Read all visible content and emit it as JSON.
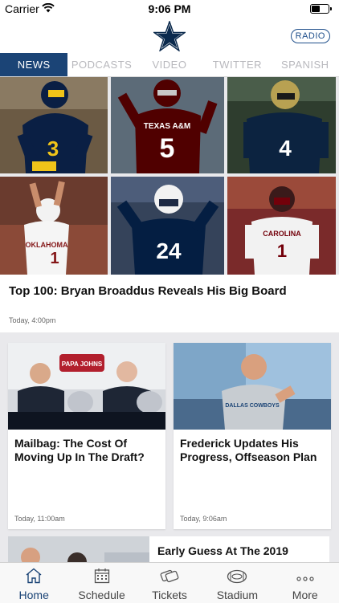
{
  "status": {
    "carrier": "Carrier",
    "time": "9:06 PM"
  },
  "header": {
    "radio": "RADIO"
  },
  "tabs": [
    "NEWS",
    "PODCASTS",
    "VIDEO",
    "TWITTER",
    "SPANISH"
  ],
  "hero": {
    "title": "Top 100: Bryan Broaddus Reveals His Big Board",
    "date": "Today, 4:00pm",
    "players": [
      {
        "jersey": "3",
        "team": ""
      },
      {
        "jersey": "5",
        "team": "TEXAS A&M"
      },
      {
        "jersey": "4",
        "team": ""
      },
      {
        "jersey": "1",
        "team": "OKLAHOMA"
      },
      {
        "jersey": "24",
        "team": ""
      },
      {
        "jersey": "1",
        "team": "CAROLINA"
      }
    ]
  },
  "cards": [
    {
      "title": "Mailbag: The Cost Of Moving Up In The Draft?",
      "date": "Today, 11:00am",
      "sign": "PAPA JOHNS"
    },
    {
      "title": "Frederick Updates His Progress, Offseason Plan",
      "date": "Today, 9:06am",
      "shirt": "DALLAS COWBOYS"
    }
  ],
  "row3": {
    "title": "Early Guess At The 2019"
  },
  "tabbar": [
    {
      "label": "Home",
      "icon": "home-icon"
    },
    {
      "label": "Schedule",
      "icon": "calendar-icon"
    },
    {
      "label": "Tickets",
      "icon": "tickets-icon"
    },
    {
      "label": "Stadium",
      "icon": "stadium-icon"
    },
    {
      "label": "More",
      "icon": "more-icon"
    }
  ],
  "colors": {
    "navy": "#1b4476",
    "tab_inactive": "#b8b8bd"
  }
}
